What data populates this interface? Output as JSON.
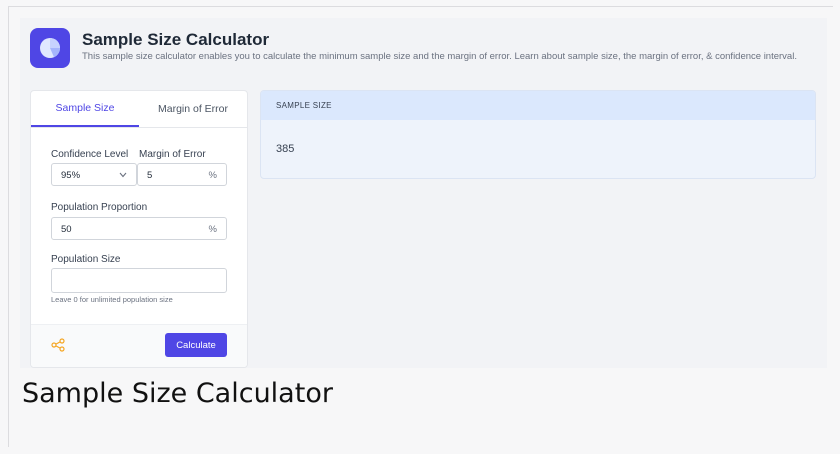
{
  "header": {
    "title": "Sample Size Calculator",
    "subtitle": "This sample size calculator enables you to calculate the minimum sample size and the margin of error. Learn about sample size, the margin of error, & confidence interval.",
    "logo_icon": "pie-chart-icon"
  },
  "tabs": [
    {
      "label": "Sample Size",
      "active": true
    },
    {
      "label": "Margin of Error",
      "active": false
    }
  ],
  "form": {
    "confidence_label": "Confidence Level",
    "confidence_value": "95%",
    "margin_label": "Margin of Error",
    "margin_value": "5",
    "margin_suffix": "%",
    "proportion_label": "Population Proportion",
    "proportion_value": "50",
    "proportion_suffix": "%",
    "population_label": "Population Size",
    "population_value": "",
    "population_hint": "Leave 0 for unlimited population size"
  },
  "footer": {
    "share_icon": "share-icon",
    "calculate_label": "Calculate"
  },
  "result": {
    "heading": "SAMPLE SIZE",
    "value": "385"
  },
  "caption": "Sample Size Calculator",
  "colors": {
    "accent": "#4f46e5",
    "share_icon": "#f5a623",
    "result_header_bg": "#dbe8fd"
  }
}
